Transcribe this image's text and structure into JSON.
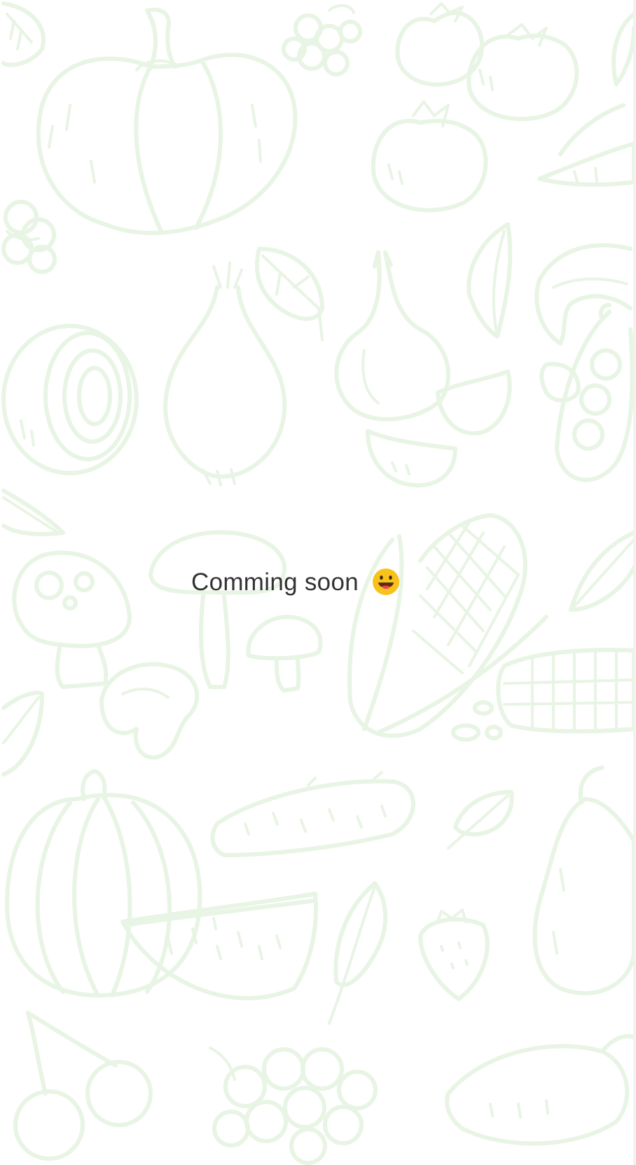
{
  "message": {
    "text": "Comming soon",
    "emoji_icon": "grinning-face-with-tongue-icon"
  },
  "colors": {
    "background": "#ffffff",
    "pattern_stroke": "#e8f4e4",
    "text": "#333333",
    "emoji_face": "#f7c21b",
    "emoji_mouth": "#5a2d0c",
    "emoji_tongue": "#e8485a"
  },
  "background": {
    "illustrations": [
      "pumpkin-icon",
      "raspberry-icon",
      "tomato-icon",
      "tomato-icon",
      "tomato-icon",
      "carrot-icon",
      "broccoli-icon",
      "onion-slice-icon",
      "onion-icon",
      "basil-leaf-icon",
      "garlic-icon",
      "garlic-clove-icon",
      "leaf-icon",
      "banana-icon",
      "pea-pod-icon",
      "mushroom-icon",
      "mushroom-icon",
      "mushroom-icon",
      "mushroom-slice-icon",
      "corn-icon",
      "corn-cob-icon",
      "leaf-icon",
      "melon-icon",
      "watermelon-slice-icon",
      "cucumber-icon",
      "herb-icon",
      "strawberry-icon",
      "pear-icon",
      "cherry-icon",
      "grapes-icon",
      "sweet-potato-icon"
    ]
  }
}
